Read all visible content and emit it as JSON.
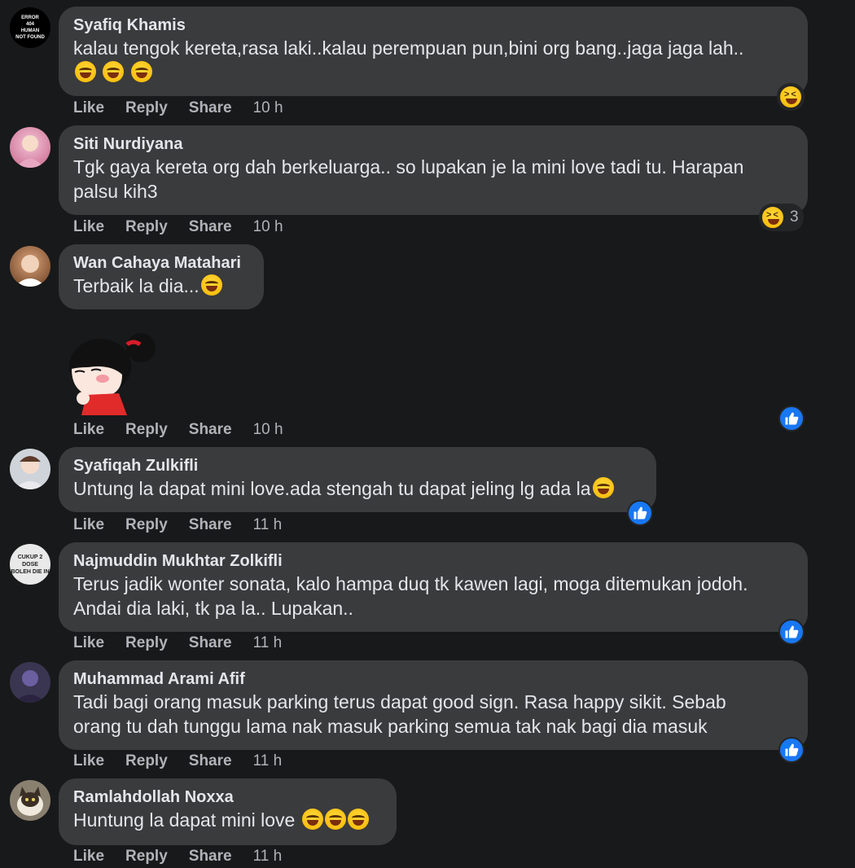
{
  "actions": {
    "like": "Like",
    "reply": "Reply",
    "share": "Share"
  },
  "comments": [
    {
      "author": "Syafiq Khamis",
      "text": "kalau tengok kereta,rasa laki..kalau perempuan pun,bini org bang..jaga jaga lah..",
      "time": "10 h",
      "avatar_text": [
        "ERROR",
        "404",
        "HUMAN",
        "NOT FOUND"
      ],
      "reaction": "haha-icon"
    },
    {
      "author": "Siti Nurdiyana",
      "text": "Tgk gaya kereta org dah berkeluarga.. so lupakan je la mini love tadi tu. Harapan\npalsu kih3",
      "time": "10 h",
      "reaction": "haha-icon",
      "reaction_count": "3"
    },
    {
      "author": "Wan Cahaya Matahari",
      "text": "Terbaik la dia...",
      "time": "10 h",
      "sticker": "pucca-sticker",
      "reaction": "like-icon"
    },
    {
      "author": "Syafiqah Zulkifli",
      "text": "Untung la dapat mini love.ada stengah tu dapat jeling lg ada la",
      "time": "11 h",
      "reaction": "like-icon"
    },
    {
      "author": "Najmuddin Mukhtar Zolkifli",
      "text": "Terus jadik wonter sonata, kalo hampa duq tk kawen lagi, moga ditemukan jodoh.\nAndai dia laki, tk pa la.. Lupakan..",
      "time": "11 h",
      "avatar_text": [
        "CUKUP 2 DOSE",
        "BOLEH DIE IN"
      ],
      "reaction": "like-icon"
    },
    {
      "author": "Muhammad Arami Afif",
      "text": "Tadi bagi orang masuk parking terus dapat good sign. Rasa happy sikit. Sebab\norang tu dah tunggu lama nak masuk parking semua tak nak bagi dia masuk",
      "time": "11 h",
      "reaction": "like-icon"
    },
    {
      "author": "Ramlahdollah Noxxa",
      "text": "Huntung la dapat mini love",
      "time": "11 h"
    }
  ],
  "colors": {
    "background": "#18191a",
    "bubble": "#3a3b3c",
    "text": "#e4e6eb",
    "muted": "#b0b3b8",
    "like_blue": "#1877f2"
  }
}
